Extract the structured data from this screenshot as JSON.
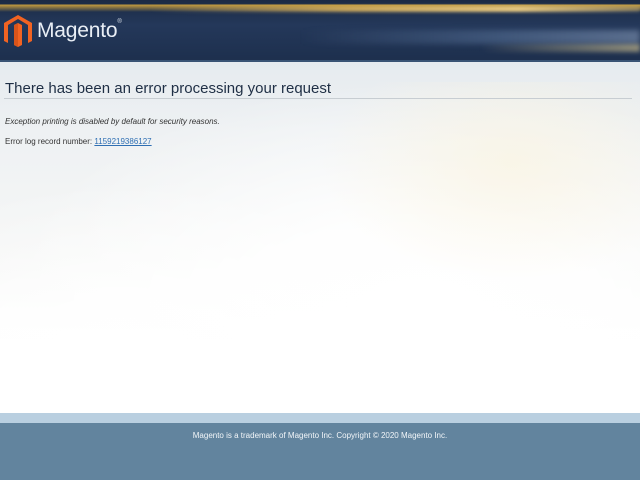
{
  "header": {
    "logo_text": "Magento",
    "logo_reg": "®",
    "icon": "magento-logo-icon",
    "accent_color": "#f26322"
  },
  "main": {
    "title": "There has been an error processing your request",
    "exception_message": "Exception printing is disabled by default for security reasons.",
    "error_log_label": "Error log record number: ",
    "error_log_number": "1159219386127"
  },
  "footer": {
    "text": "Magento is a trademark of Magento Inc. Copyright © 2020 Magento Inc."
  }
}
